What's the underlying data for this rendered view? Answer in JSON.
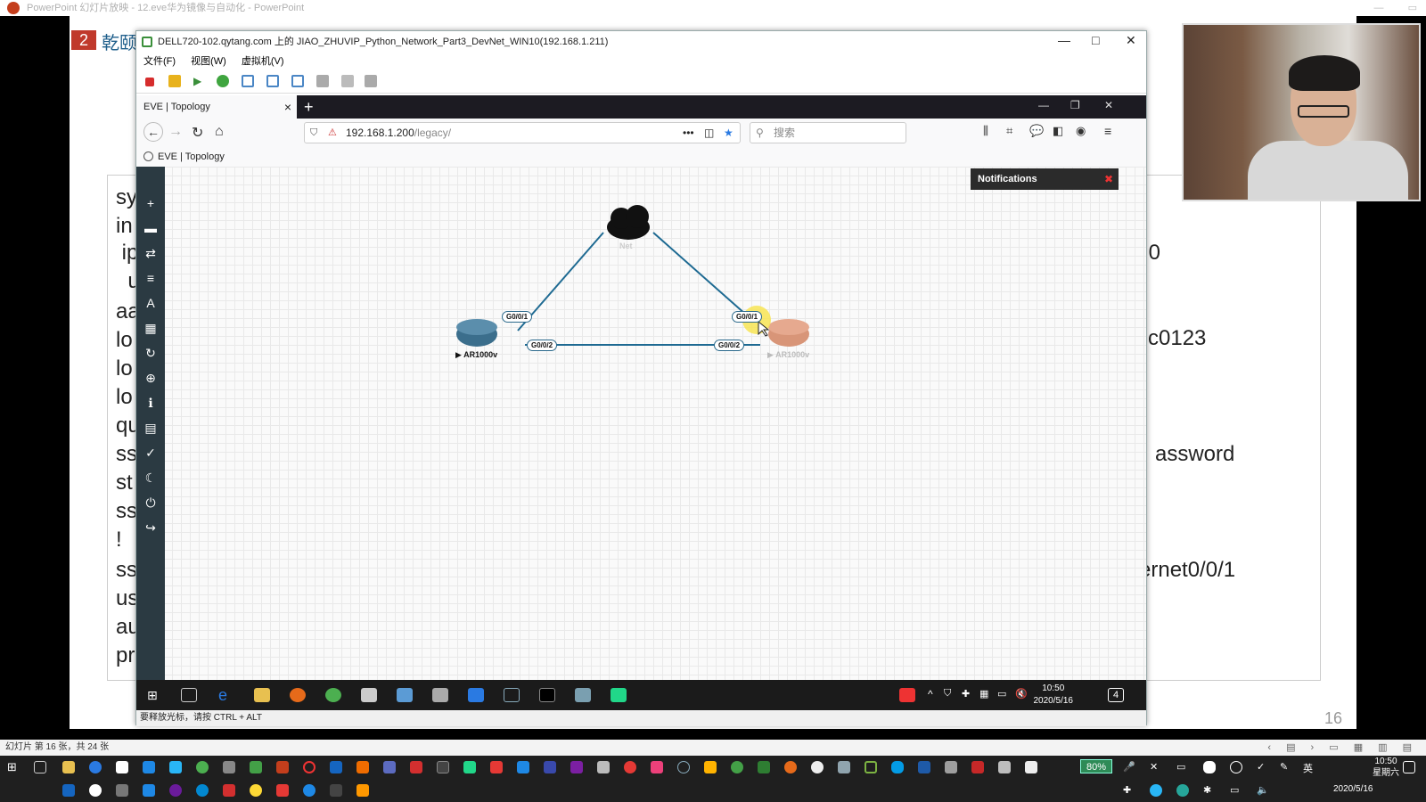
{
  "powerpoint": {
    "title_bar": "PowerPoint 幻灯片放映  -  12.eve华为镜像与自动化 - PowerPoint",
    "slide_badge": "2",
    "slide_title": "乾颐",
    "slide_left_lines": [
      "sy",
      "in",
      " ip",
      "  u",
      "aa",
      "lo",
      "lo",
      "lo",
      "qu",
      "ss",
      "st",
      "ss",
      "!",
      "ss",
      "us",
      "au",
      "pr"
    ],
    "slide_right_lines": [
      ".0",
      "c0123",
      "assword",
      "ernet0/0/1"
    ],
    "page_number": "16",
    "status_text": "幻灯片 第 16 张，共 24 张"
  },
  "vm_window": {
    "title": "DELL720-102.qytang.com 上的 JIAO_ZHUVIP_Python_Network_Part3_DevNet_WIN10(192.168.1.211)",
    "menu": [
      "文件(F)",
      "视图(W)",
      "虚拟机(V)"
    ],
    "status_hint": "要释放光标，请按 CTRL + ALT",
    "clock_time": "10:50",
    "clock_date": "2020/5/16",
    "notification_count": "4"
  },
  "browser": {
    "tab_title": "EVE | Topology",
    "url_host": "192.168.1.200",
    "url_path": "/legacy/",
    "search_placeholder": "搜索",
    "bookmark_title": "EVE | Topology"
  },
  "eve": {
    "notifications_title": "Notifications",
    "nodes": {
      "cloud": "Net",
      "router_left": "AR1000v",
      "router_right": "AR1000v"
    },
    "interfaces": {
      "left_top": "G0/0/1",
      "left_bottom": "G0/0/2",
      "right_top": "G0/0/1",
      "right_bottom": "G0/0/2"
    }
  },
  "host": {
    "zoom": "80%",
    "clock_time": "10:50",
    "clock_weekday": "星期六",
    "clock_date": "2020/5/16"
  },
  "colors": {
    "link": "#1e6a92",
    "router_left": "#3b6e8c",
    "router_right": "#d89578",
    "sidebar": "#2b3a42"
  }
}
